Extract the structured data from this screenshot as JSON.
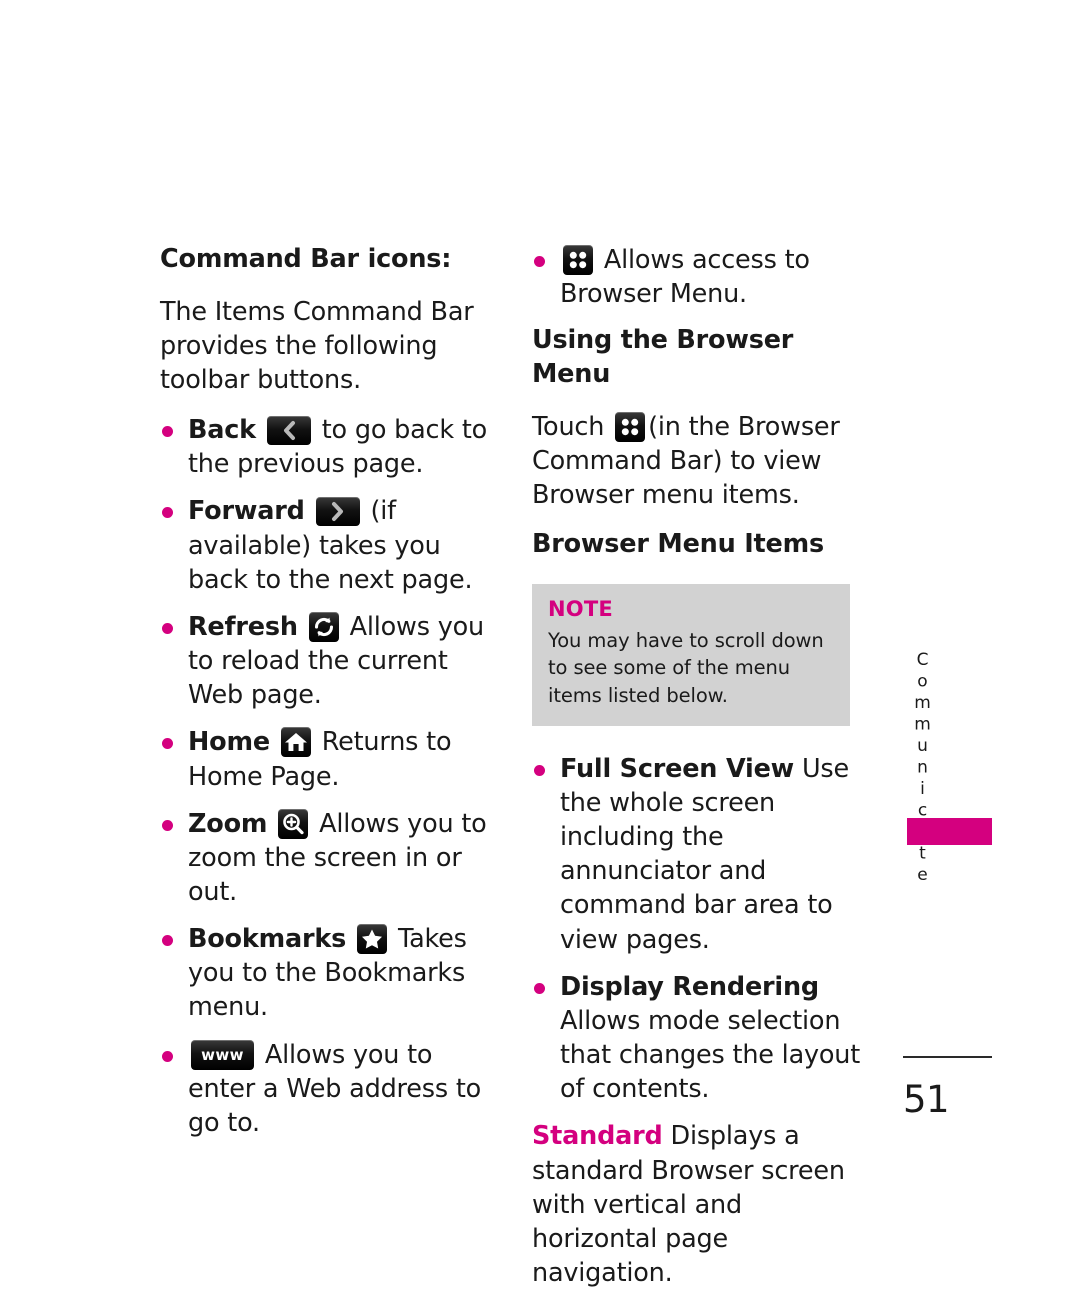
{
  "page": {
    "number": "51",
    "side_tab_label": "Communicate",
    "accent_color": "#D4007F",
    "note_background": "#d2d2d2"
  },
  "left_column": {
    "heading": "Command Bar icons:",
    "intro": "The Items Command Bar provides the following toolbar buttons.",
    "items": [
      {
        "label": "Back",
        "icon": "back-chevron-icon",
        "text_after": "to go back to the previous page."
      },
      {
        "label": "Forward",
        "icon": "forward-chevron-icon",
        "text_after": "(if available) takes you back to the next page."
      },
      {
        "label": "Refresh",
        "icon": "refresh-icon",
        "text_after": "Allows you to reload the current Web page."
      },
      {
        "label": "Home",
        "icon": "home-icon",
        "text_after": "Returns to Home Page."
      },
      {
        "label": "Zoom",
        "icon": "zoom-magnifier-icon",
        "text_after": "Allows you to zoom the screen in or out."
      },
      {
        "label": "Bookmarks",
        "icon": "bookmarks-star-icon",
        "text_after": "Takes you to the Bookmarks menu."
      },
      {
        "label": "",
        "icon": "www-icon",
        "icon_text": "www",
        "text_after": "Allows you to enter a Web address to go to."
      }
    ]
  },
  "right_column": {
    "menu_bullet": {
      "icon": "browser-menu-grid-icon",
      "text": "Allows access to Browser Menu."
    },
    "heading_using": "Using the Browser Menu",
    "touch_before": "Touch",
    "touch_icon": "browser-menu-grid-icon",
    "touch_after": "(in the Browser Command Bar) to view Browser menu items.",
    "heading_items": "Browser Menu Items",
    "note": {
      "title": "NOTE",
      "body": "You may have to scroll down to see some of the menu items listed below."
    },
    "items": [
      {
        "label": "Full Screen View",
        "text_after": "Use the whole screen including the annunciator and command bar area to view pages."
      },
      {
        "label": "Display Rendering",
        "text_after": "Allows mode selection that changes the layout of contents."
      }
    ],
    "sub_item": {
      "label": "Standard",
      "text_after": "Displays a standard Browser screen with vertical and horizontal page navigation."
    }
  }
}
